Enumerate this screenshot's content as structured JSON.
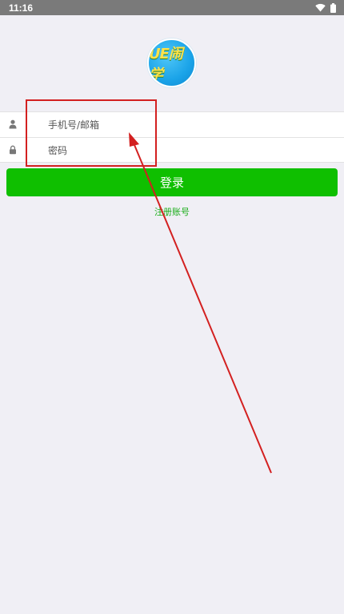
{
  "status_bar": {
    "time": "11:16",
    "icons": [
      "wifi-icon",
      "battery-icon"
    ]
  },
  "logo": {
    "text": "UE闹学",
    "colors": {
      "background": "#1aa3e8",
      "text": "#ffe24a"
    }
  },
  "form": {
    "username": {
      "value": "",
      "placeholder": "手机号/邮箱",
      "icon": "user-icon"
    },
    "password": {
      "value": "",
      "placeholder": "密码",
      "icon": "lock-icon"
    }
  },
  "login_button": {
    "label": "登录",
    "color": "#0fbf00"
  },
  "register_link": {
    "label": "注册账号",
    "color": "#1aad19"
  },
  "annotation": {
    "color": "#d32020",
    "shapes": [
      "highlight-box",
      "arrow"
    ]
  }
}
